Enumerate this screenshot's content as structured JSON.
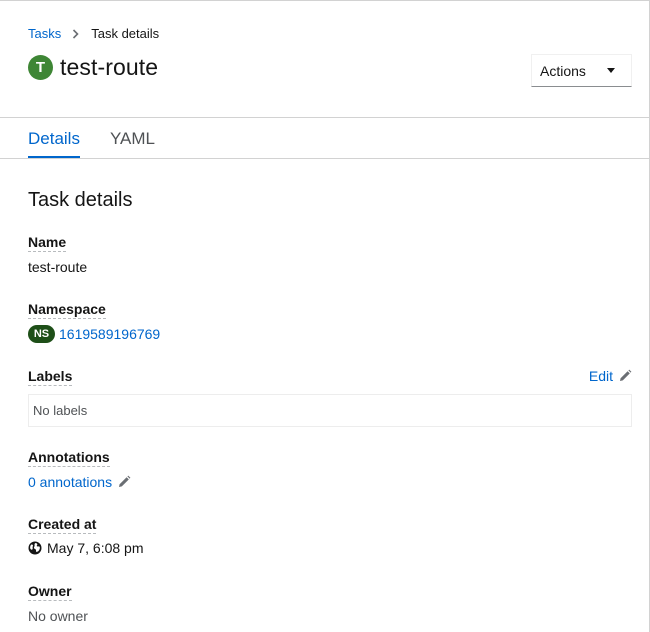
{
  "breadcrumb": {
    "parent": "Tasks",
    "current": "Task details"
  },
  "header": {
    "badge": "T",
    "title": "test-route",
    "actions_label": "Actions"
  },
  "tabs": [
    {
      "label": "Details",
      "active": true
    },
    {
      "label": "YAML",
      "active": false
    }
  ],
  "details": {
    "section_title": "Task details",
    "name_label": "Name",
    "name_value": "test-route",
    "namespace_label": "Namespace",
    "namespace_badge": "NS",
    "namespace_value": "1619589196769",
    "labels_label": "Labels",
    "labels_edit": "Edit",
    "labels_empty": "No labels",
    "annotations_label": "Annotations",
    "annotations_value": "0 annotations",
    "created_label": "Created at",
    "created_value": "May 7, 6:08 pm",
    "owner_label": "Owner",
    "owner_value": "No owner"
  },
  "icons": {
    "separator": "chevron-right-icon",
    "edit": "pencil-icon",
    "created": "globe-icon",
    "dropdown": "caret-down-icon"
  },
  "colors": {
    "link": "#0066cc",
    "task_badge": "#3e8635",
    "namespace_badge": "#1e4f18"
  }
}
